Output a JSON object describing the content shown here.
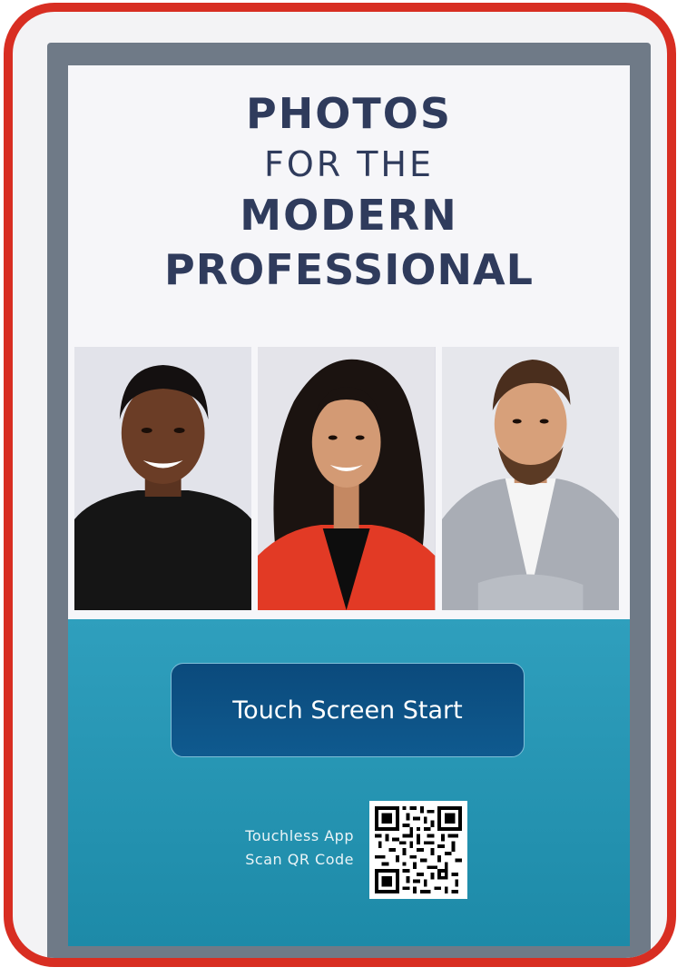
{
  "headline": {
    "line1": "PHOTOS",
    "line2": "FOR THE",
    "line3": "MODERN",
    "line4": "PROFESSIONAL"
  },
  "photos": [
    {
      "name": "portrait-1"
    },
    {
      "name": "portrait-2"
    },
    {
      "name": "portrait-3"
    }
  ],
  "start_button": {
    "label": "Touch Screen Start"
  },
  "touchless": {
    "line1": "Touchless App",
    "line2": "Scan QR Code"
  },
  "icons": {
    "qr": "qr-code-icon"
  },
  "colors": {
    "frame": "#d82e22",
    "heading": "#2f3b5c",
    "teal": "#1d8aa8",
    "button": "#0b4a7c"
  }
}
